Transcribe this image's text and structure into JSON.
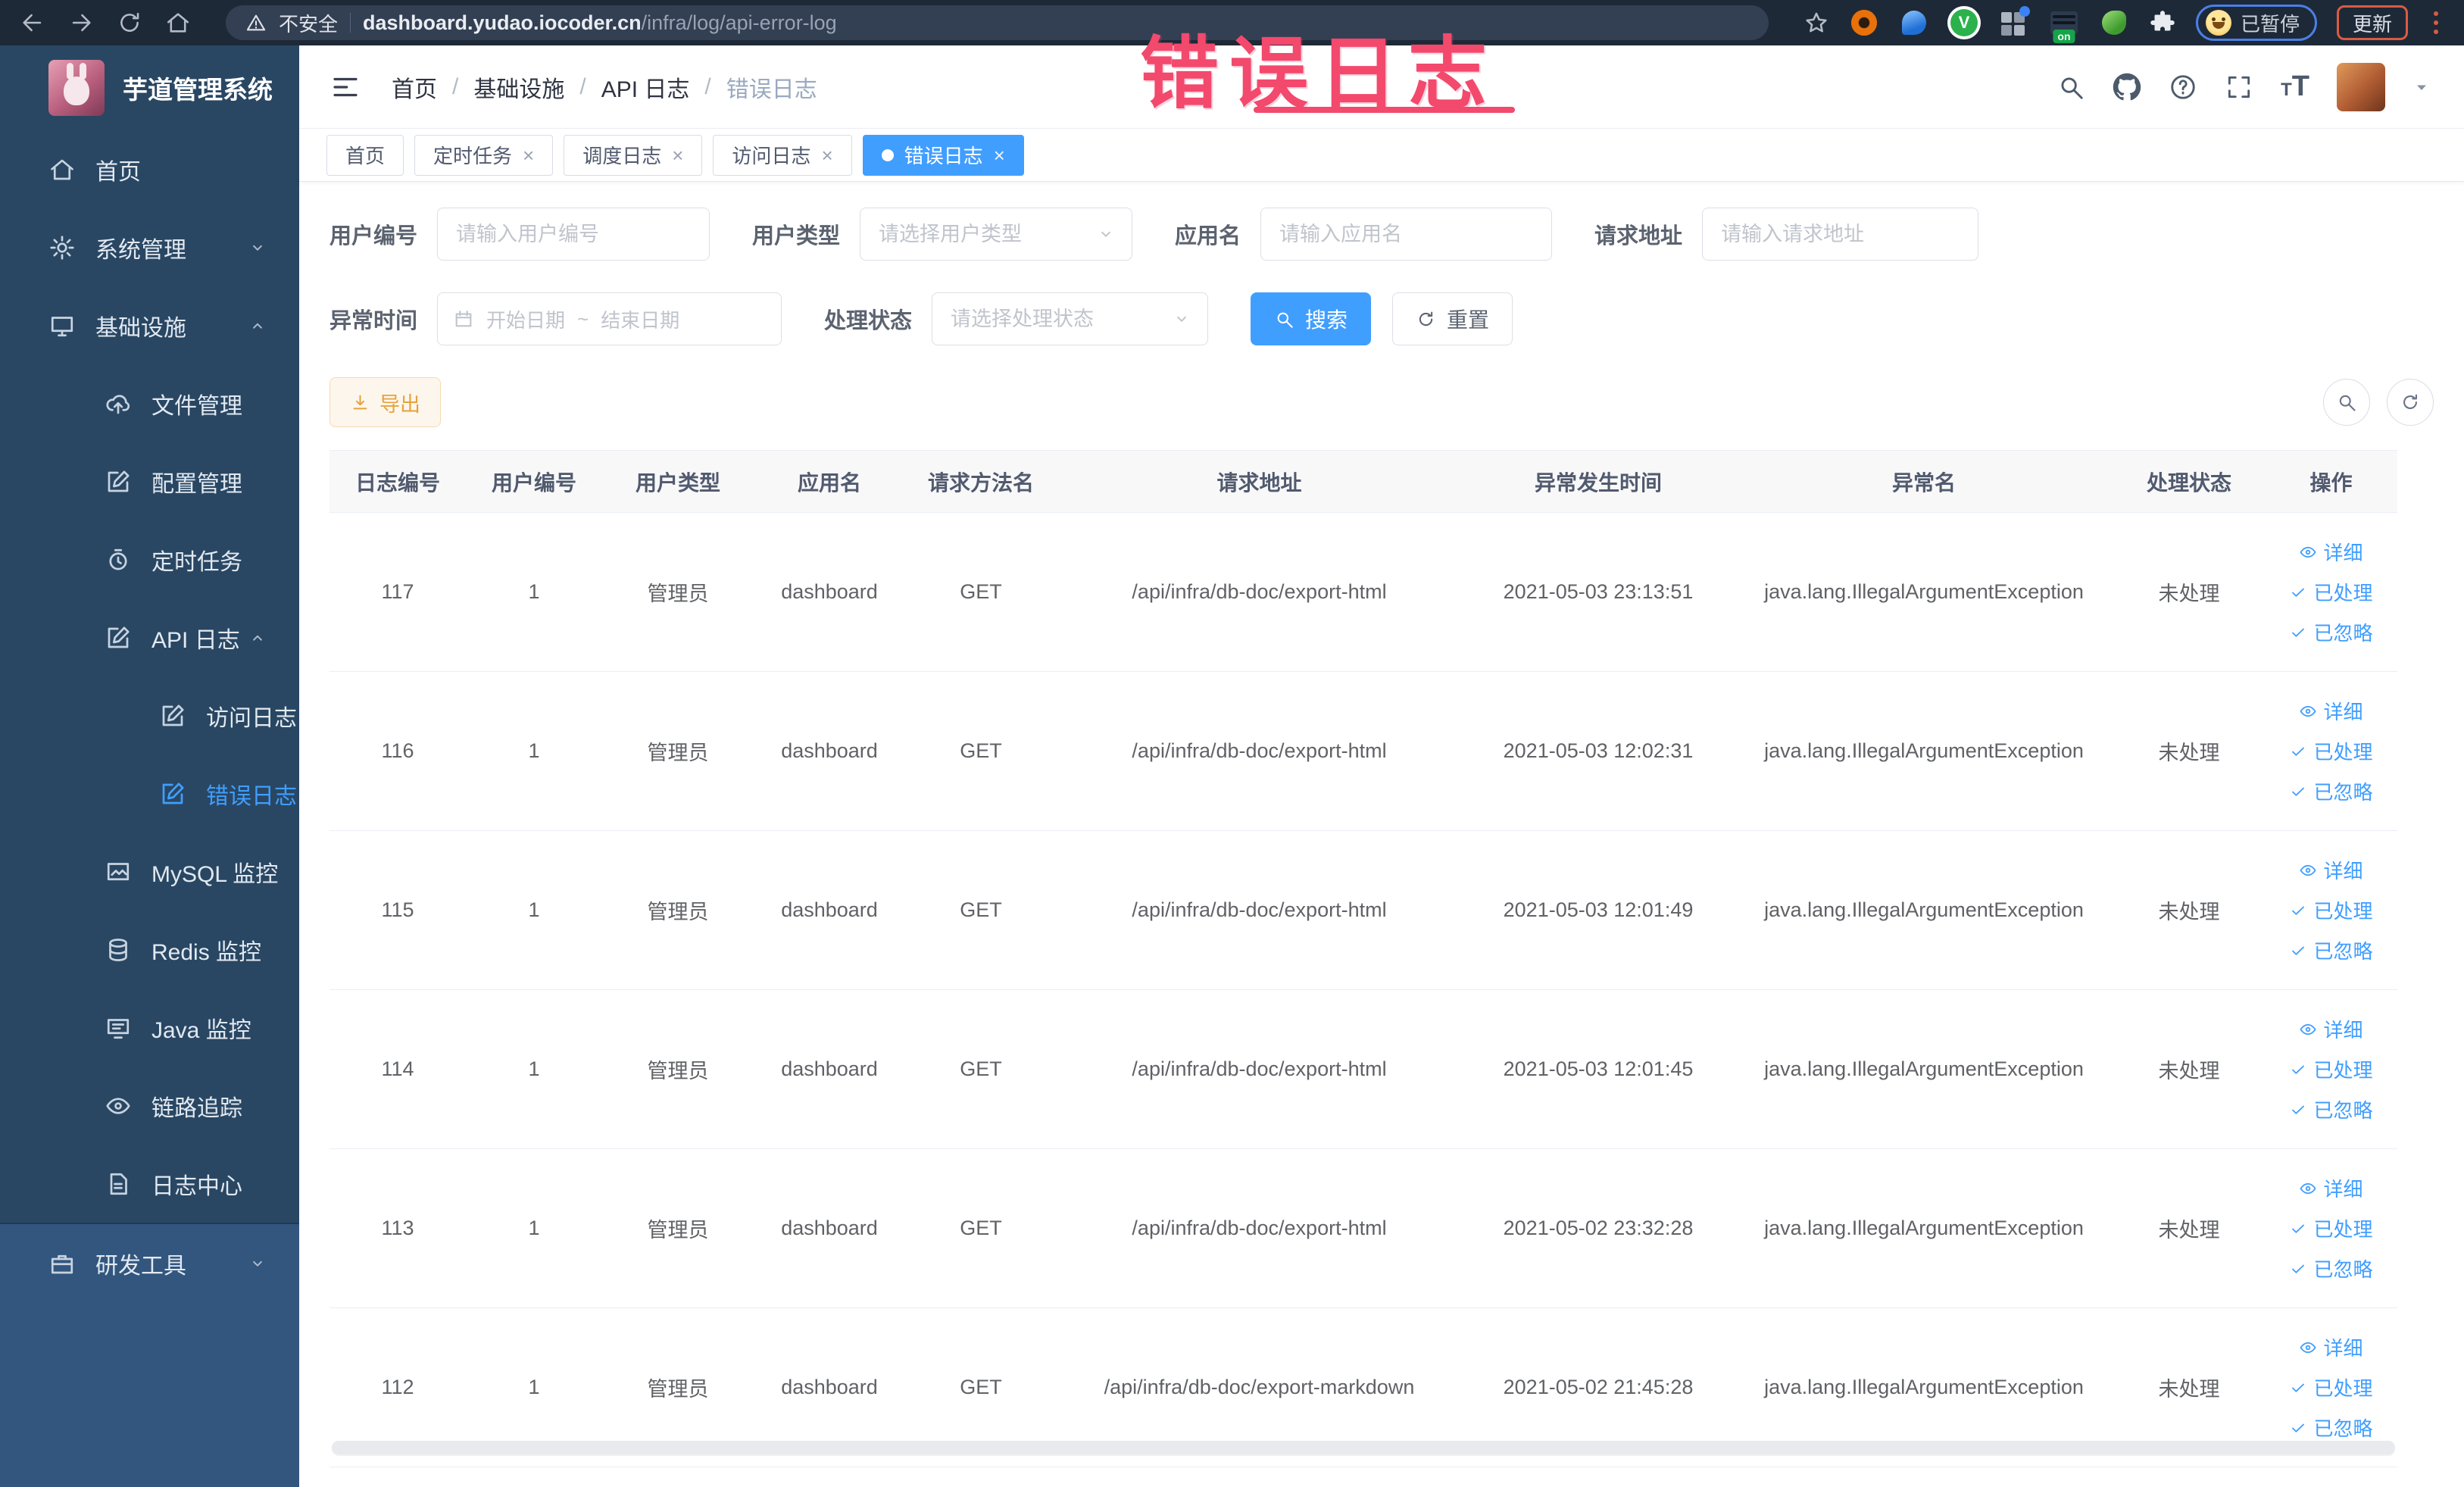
{
  "browser": {
    "security_label": "不安全",
    "url_host": "dashboard.yudao.iocoder.cn",
    "url_path": "/infra/log/api-error-log",
    "paused_badge": "已暂停",
    "update_button": "更新"
  },
  "annotation": {
    "text": "错误日志"
  },
  "sidebar": {
    "title": "芋道管理系统",
    "items": [
      {
        "label": "首页",
        "icon": "home-icon",
        "level": 1
      },
      {
        "label": "系统管理",
        "icon": "gear-icon",
        "level": 1,
        "chevron": "down"
      },
      {
        "label": "基础设施",
        "icon": "monitor-icon",
        "level": 1,
        "chevron": "up"
      },
      {
        "label": "文件管理",
        "icon": "cloud-upload-icon",
        "level": 2
      },
      {
        "label": "配置管理",
        "icon": "edit-square-icon",
        "level": 2
      },
      {
        "label": "定时任务",
        "icon": "timer-icon",
        "level": 2
      },
      {
        "label": "API 日志",
        "icon": "edit-square-icon",
        "level": 2,
        "chevron": "up"
      },
      {
        "label": "访问日志",
        "icon": "edit-square-icon",
        "level": 3
      },
      {
        "label": "错误日志",
        "icon": "edit-square-icon",
        "level": 3,
        "active": true
      },
      {
        "label": "MySQL 监控",
        "icon": "chart-icon",
        "level": 2
      },
      {
        "label": "Redis 监控",
        "icon": "database-icon",
        "level": 2
      },
      {
        "label": "Java 监控",
        "icon": "java-monitor-icon",
        "level": 2
      },
      {
        "label": "链路追踪",
        "icon": "eye-icon",
        "level": 2
      },
      {
        "label": "日志中心",
        "icon": "doc-icon",
        "level": 2
      }
    ],
    "bottom_item": {
      "label": "研发工具",
      "icon": "briefcase-icon",
      "level": 1,
      "chevron": "down"
    }
  },
  "breadcrumb": [
    "首页",
    "基础设施",
    "API 日志",
    "错误日志"
  ],
  "tabs": [
    {
      "label": "首页",
      "closable": false,
      "active": false
    },
    {
      "label": "定时任务",
      "closable": true,
      "active": false
    },
    {
      "label": "调度日志",
      "closable": true,
      "active": false
    },
    {
      "label": "访问日志",
      "closable": true,
      "active": false
    },
    {
      "label": "错误日志",
      "closable": true,
      "active": true
    }
  ],
  "filters": {
    "user_id": {
      "label": "用户编号",
      "placeholder": "请输入用户编号"
    },
    "user_type": {
      "label": "用户类型",
      "placeholder": "请选择用户类型"
    },
    "app_name": {
      "label": "应用名",
      "placeholder": "请输入应用名"
    },
    "request_url": {
      "label": "请求地址",
      "placeholder": "请输入请求地址"
    },
    "exception_time": {
      "label": "异常时间",
      "start_placeholder": "开始日期",
      "separator": "~",
      "end_placeholder": "结束日期"
    },
    "process_status": {
      "label": "处理状态",
      "placeholder": "请选择处理状态"
    },
    "search_label": "搜索",
    "reset_label": "重置"
  },
  "toolbar": {
    "export_label": "导出"
  },
  "table": {
    "columns": [
      "日志编号",
      "用户编号",
      "用户类型",
      "应用名",
      "请求方法名",
      "请求地址",
      "异常发生时间",
      "异常名",
      "处理状态",
      "操作"
    ],
    "actions": [
      "详细",
      "已处理",
      "已忽略"
    ],
    "rows": [
      {
        "id": "117",
        "user_id": "1",
        "user_type": "管理员",
        "app": "dashboard",
        "method": "GET",
        "url": "/api/infra/db-doc/export-html",
        "time": "2021-05-03 23:13:51",
        "exception": "java.lang.IllegalArgumentException",
        "status": "未处理"
      },
      {
        "id": "116",
        "user_id": "1",
        "user_type": "管理员",
        "app": "dashboard",
        "method": "GET",
        "url": "/api/infra/db-doc/export-html",
        "time": "2021-05-03 12:02:31",
        "exception": "java.lang.IllegalArgumentException",
        "status": "未处理"
      },
      {
        "id": "115",
        "user_id": "1",
        "user_type": "管理员",
        "app": "dashboard",
        "method": "GET",
        "url": "/api/infra/db-doc/export-html",
        "time": "2021-05-03 12:01:49",
        "exception": "java.lang.IllegalArgumentException",
        "status": "未处理"
      },
      {
        "id": "114",
        "user_id": "1",
        "user_type": "管理员",
        "app": "dashboard",
        "method": "GET",
        "url": "/api/infra/db-doc/export-html",
        "time": "2021-05-03 12:01:45",
        "exception": "java.lang.IllegalArgumentException",
        "status": "未处理"
      },
      {
        "id": "113",
        "user_id": "1",
        "user_type": "管理员",
        "app": "dashboard",
        "method": "GET",
        "url": "/api/infra/db-doc/export-html",
        "time": "2021-05-02 23:32:28",
        "exception": "java.lang.IllegalArgumentException",
        "status": "未处理"
      },
      {
        "id": "112",
        "user_id": "1",
        "user_type": "管理员",
        "app": "dashboard",
        "method": "GET",
        "url": "/api/infra/db-doc/export-markdown",
        "time": "2021-05-02 21:45:28",
        "exception": "java.lang.IllegalArgumentException",
        "status": "未处理"
      }
    ]
  }
}
